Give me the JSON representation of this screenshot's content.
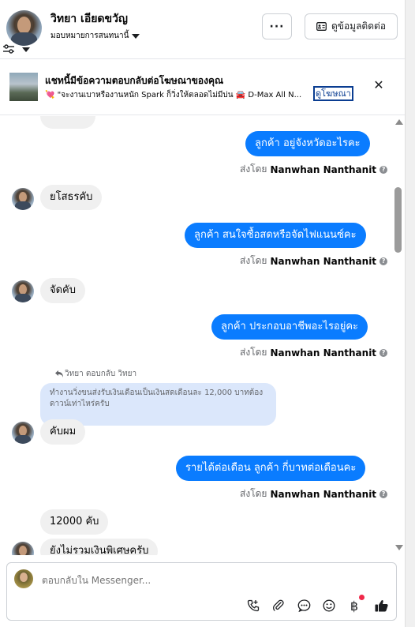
{
  "header": {
    "name": "วิทยา เอียดขวัญ",
    "assign_label": "มอบหมายการสนทนานี้",
    "more_label": "···",
    "contact_button": "ดูข้อมูลติดต่อ"
  },
  "ad": {
    "title": "แชทนี้มีข้อความตอบกลับต่อโฆษณาของคุณ",
    "subtitle": "💘 \"จะงานเบาหรืองานหนัก Spark ก็วิ่งให้ตลอดไม่มีบ่น 🚘 D-Max All N...",
    "link_label": "ดูโฆษณา"
  },
  "messages": {
    "m1": "ลูกค้า อยู่จังหวัดอะไรคะ",
    "m2": "ยโสธรคับ",
    "m3": "ลูกค้า สนใจซื้อสดหรือจัดไฟแนนซ์คะ",
    "m4": "จัดคับ",
    "m5": "ลูกค้า ประกอบอาชีพอะไรอยู่คะ",
    "reply_note": "วิทยา ตอบกลับ วิทยา",
    "quoted": "ทำงานวิ่งขนส่งรับเงินเดือนเป็นเงินสดเดือนละ 12,000 บาทต้องดาวน์เท่าไหร่ครับ",
    "m6": "คับผม",
    "m7": "รายได้ต่อเดือน ลูกค้า กี่บาทต่อเดือนคะ",
    "m8": "12000 คับ",
    "m9": "ยังไม่รวมเงินพิเศษครับ"
  },
  "sent_by": {
    "prefix": "ส่งโดย",
    "agent": "Nanwhan Nanthanit"
  },
  "composer": {
    "placeholder": "ตอบกลับใน Messenger..."
  },
  "colors": {
    "outgoing": "#0a7cff",
    "incoming": "#f0f0f0",
    "quoted": "#dbe7fb"
  }
}
